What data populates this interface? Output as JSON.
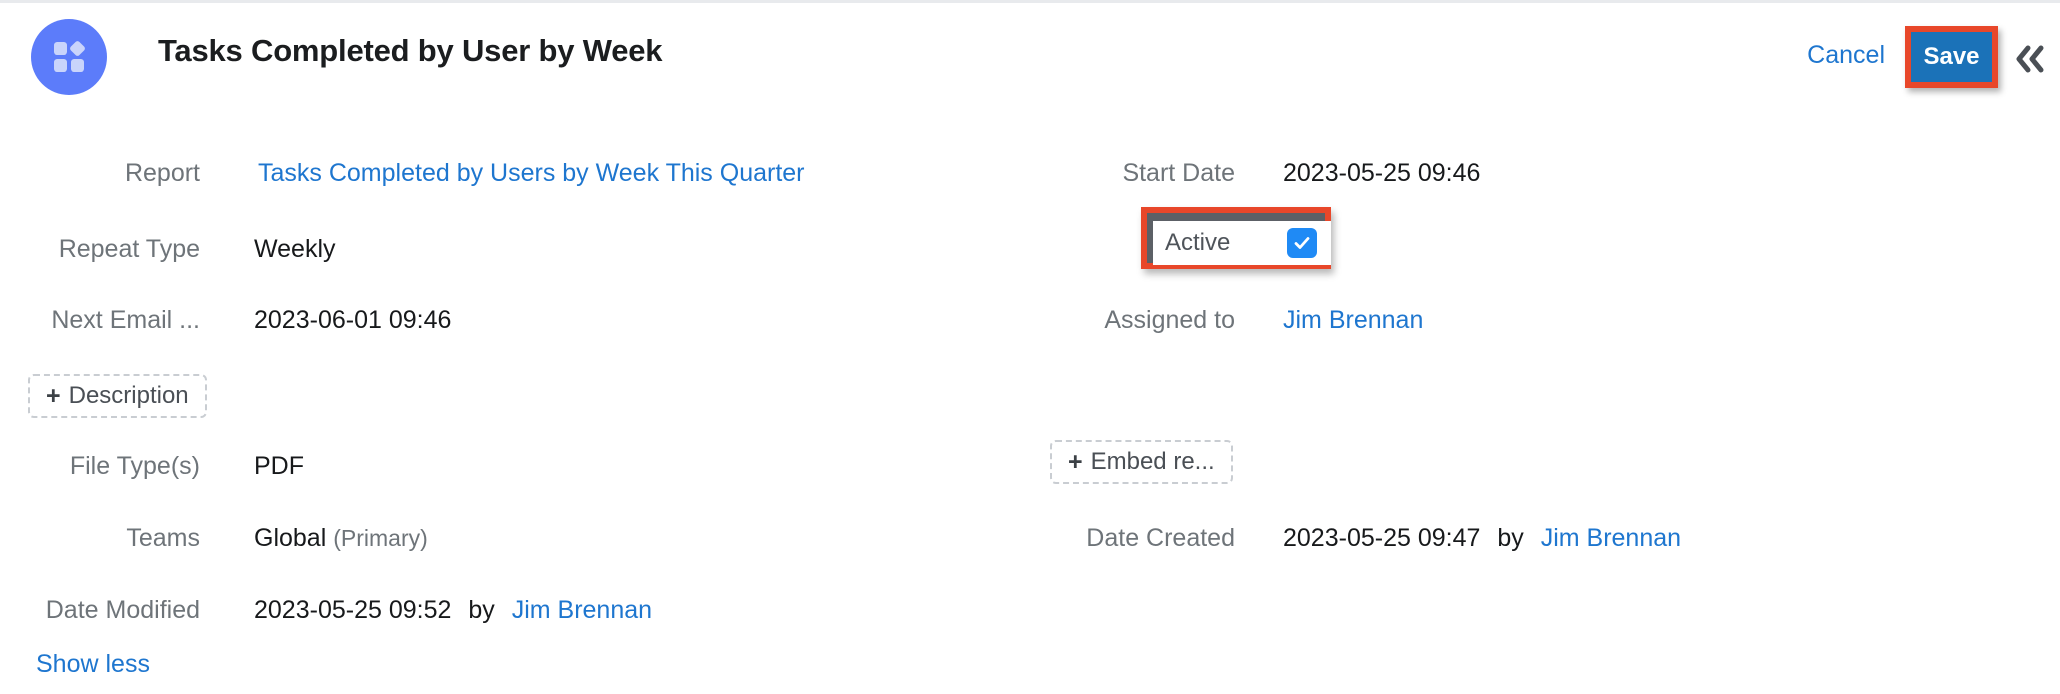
{
  "header": {
    "avatar_icon": "reports-grid-icon",
    "title": "Tasks Completed by User by Week",
    "cancel_label": "Cancel",
    "save_label": "Save",
    "collapse_icon": "double-chevron-left-icon"
  },
  "colors": {
    "accent_blue": "#5c7cfa",
    "link_blue": "#1e76cf",
    "save_button_blue": "#1b72b8",
    "highlight_red": "#e8472a",
    "checkbox_blue": "#1f8af5",
    "label_grey": "#6e7479",
    "value_dark": "#17191b"
  },
  "fields": {
    "report": {
      "label": "Report",
      "value": "Tasks Completed by Users by Week This Quarter",
      "is_link": true
    },
    "repeat_type": {
      "label": "Repeat Type",
      "value": "Weekly",
      "is_link": false
    },
    "next_email": {
      "label": "Next Email ...",
      "value": "2023-06-01 09:46",
      "is_link": false
    },
    "file_types": {
      "label": "File Type(s)",
      "value": "PDF",
      "is_link": false
    },
    "teams": {
      "label": "Teams",
      "value": "Global",
      "suffix": "(Primary)",
      "is_link": false
    },
    "date_modified": {
      "label": "Date Modified",
      "value": "2023-05-25 09:52",
      "by": "by",
      "user": "Jim Brennan"
    },
    "start_date": {
      "label": "Start Date",
      "value": "2023-05-25 09:46",
      "is_link": false
    },
    "assigned_to": {
      "label": "Assigned to",
      "value": "Jim Brennan",
      "is_link": true
    },
    "date_created": {
      "label": "Date Created",
      "value": "2023-05-25 09:47",
      "by": "by",
      "user": "Jim Brennan"
    }
  },
  "active_checkbox": {
    "label": "Active",
    "checked": true,
    "checked_glyph": "checkmark-icon"
  },
  "chips": {
    "description": {
      "plus": "+",
      "label": "Description"
    },
    "embed_report": {
      "plus": "+",
      "label": "Embed re..."
    }
  },
  "footer": {
    "show_less_label": "Show less"
  }
}
